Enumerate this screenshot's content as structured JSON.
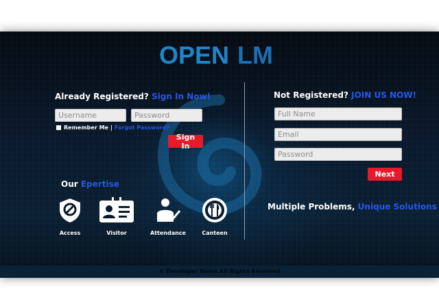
{
  "brand": {
    "logo_part1": "OPEN",
    "logo_part2": "LM",
    "logo_colors": {
      "part1": "#1f84c8",
      "part2": "#1a6fb3"
    }
  },
  "colors": {
    "accent_blue": "#2458e6",
    "button_red": "#e8192b",
    "background_dark": "#06121d"
  },
  "signin": {
    "heading_prefix": "Already Registered?",
    "heading_link": "Sign In Now!",
    "username_placeholder": "Username",
    "password_placeholder": "Password",
    "remember_label": "Remember Me",
    "separator": "|",
    "forgot_label": "Forgot Password?",
    "button_label": "Sign In"
  },
  "expertise": {
    "heading_prefix": "Our",
    "heading_accent": "Epertise",
    "items": [
      {
        "label": "Access",
        "icon": "no-entry-shield-icon"
      },
      {
        "label": "Visitor",
        "icon": "id-card-icon"
      },
      {
        "label": "Attendance",
        "icon": "person-check-icon"
      },
      {
        "label": "Canteen",
        "icon": "fork-knife-plate-icon"
      }
    ]
  },
  "register": {
    "heading_prefix": "Not Registered?",
    "heading_link": "JOIN US NOW!",
    "fullname_placeholder": "Full Name",
    "email_placeholder": "Email",
    "password_placeholder": "Password",
    "button_label": "Next"
  },
  "tagline": {
    "prefix": "Multiple Problems,",
    "accent": "Unique Solutions"
  },
  "footer": {
    "text": "© Developer Name.All Rights Reserved"
  }
}
